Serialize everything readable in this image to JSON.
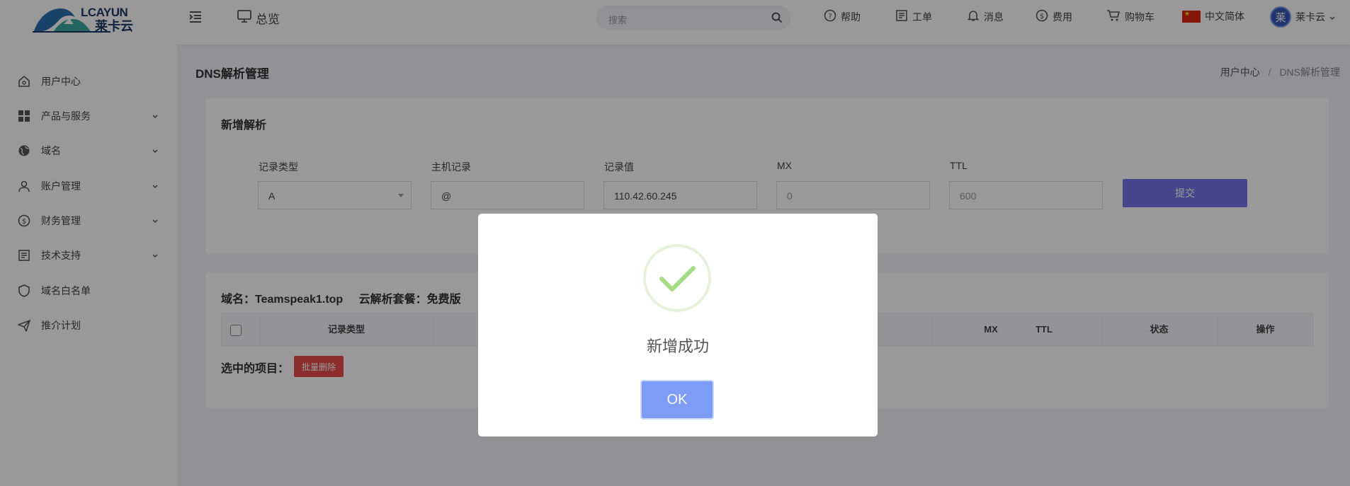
{
  "header": {
    "logo_text": "LCAYUN",
    "logo_cn": "莱卡云",
    "overview": "总览",
    "search_placeholder": "搜索",
    "nav": {
      "help": "帮助",
      "ticket": "工单",
      "message": "消息",
      "fee": "费用",
      "cart": "购物车",
      "language": "中文简体",
      "user_initial": "莱",
      "user_name": "莱卡云"
    }
  },
  "sidebar": {
    "items": [
      {
        "label": "用户中心",
        "icon": "home-icon"
      },
      {
        "label": "产品与服务",
        "icon": "grid-icon"
      },
      {
        "label": "域名",
        "icon": "globe-icon"
      },
      {
        "label": "账户管理",
        "icon": "user-icon"
      },
      {
        "label": "财务管理",
        "icon": "dollar-icon"
      },
      {
        "label": "技术支持",
        "icon": "document-icon"
      },
      {
        "label": "域名白名单",
        "icon": "shield-icon"
      },
      {
        "label": "推介计划",
        "icon": "send-icon"
      }
    ]
  },
  "page": {
    "title": "DNS解析管理",
    "breadcrumb": [
      "用户中心",
      "DNS解析管理"
    ]
  },
  "form": {
    "title": "新增解析",
    "labels": {
      "record_type": "记录类型",
      "host": "主机记录",
      "value": "记录值",
      "mx": "MX",
      "ttl": "TTL"
    },
    "values": {
      "record_type": "A",
      "host": "@",
      "value": "110.42.60.245"
    },
    "placeholders": {
      "mx": "0",
      "ttl": "600"
    },
    "submit": "提交"
  },
  "records": {
    "domain_label": "域名：Teamspeak1.top",
    "plan_label": "云解析套餐：免费版",
    "columns": [
      "记录类型",
      "MX",
      "TTL",
      "状态",
      "操作"
    ],
    "selected_label": "选中的项目：",
    "batch_delete": "批量删除"
  },
  "modal": {
    "title": "新增成功",
    "ok": "OK",
    "colors": {
      "success": "#a5dc86",
      "button": "#7d9cf7"
    }
  }
}
